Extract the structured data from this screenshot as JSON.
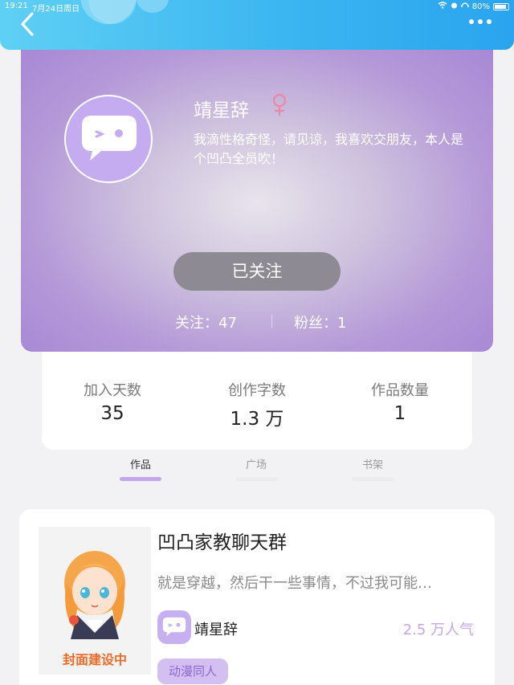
{
  "status_bar": {
    "time": "19:21",
    "date": "7月24日周日",
    "battery": "80%"
  },
  "profile": {
    "nickname": "靖星辞",
    "gender_symbol": "♀",
    "bio": "我滴性格奇怪，请见谅，我喜欢交朋友，本人是个凹凸全员吹！",
    "follow_button_label": "已关注",
    "following_label": "关注：47",
    "fans_label": "粉丝：1"
  },
  "stats": [
    {
      "label": "加入天数",
      "value": "35"
    },
    {
      "label": "创作字数",
      "value": "1.3 万"
    },
    {
      "label": "作品数量",
      "value": "1"
    }
  ],
  "tabs": [
    {
      "label": "作品",
      "active": true
    },
    {
      "label": "广场",
      "active": false
    },
    {
      "label": "书架",
      "active": false
    }
  ],
  "works": [
    {
      "cover_text": "封面建设中",
      "title": "凹凸家教聊天群",
      "description": "就是穿越，然后干一些事情，不过我可能…",
      "author": "靖星辞",
      "popularity": "2.5 万人气",
      "tag": "动漫同人"
    }
  ],
  "colors": {
    "accent_purple": "#a687d6",
    "nav_blue": "#3cb6f0",
    "tag_bg": "#d4bff2",
    "popularity": "#c8a5e8",
    "gender_pink": "#e88aa8"
  },
  "icons": {
    "back": "chevron-left-icon",
    "more": "more-dots-icon",
    "gender": "female-symbol-icon",
    "avatar": "chat-bubble-wink-icon"
  }
}
